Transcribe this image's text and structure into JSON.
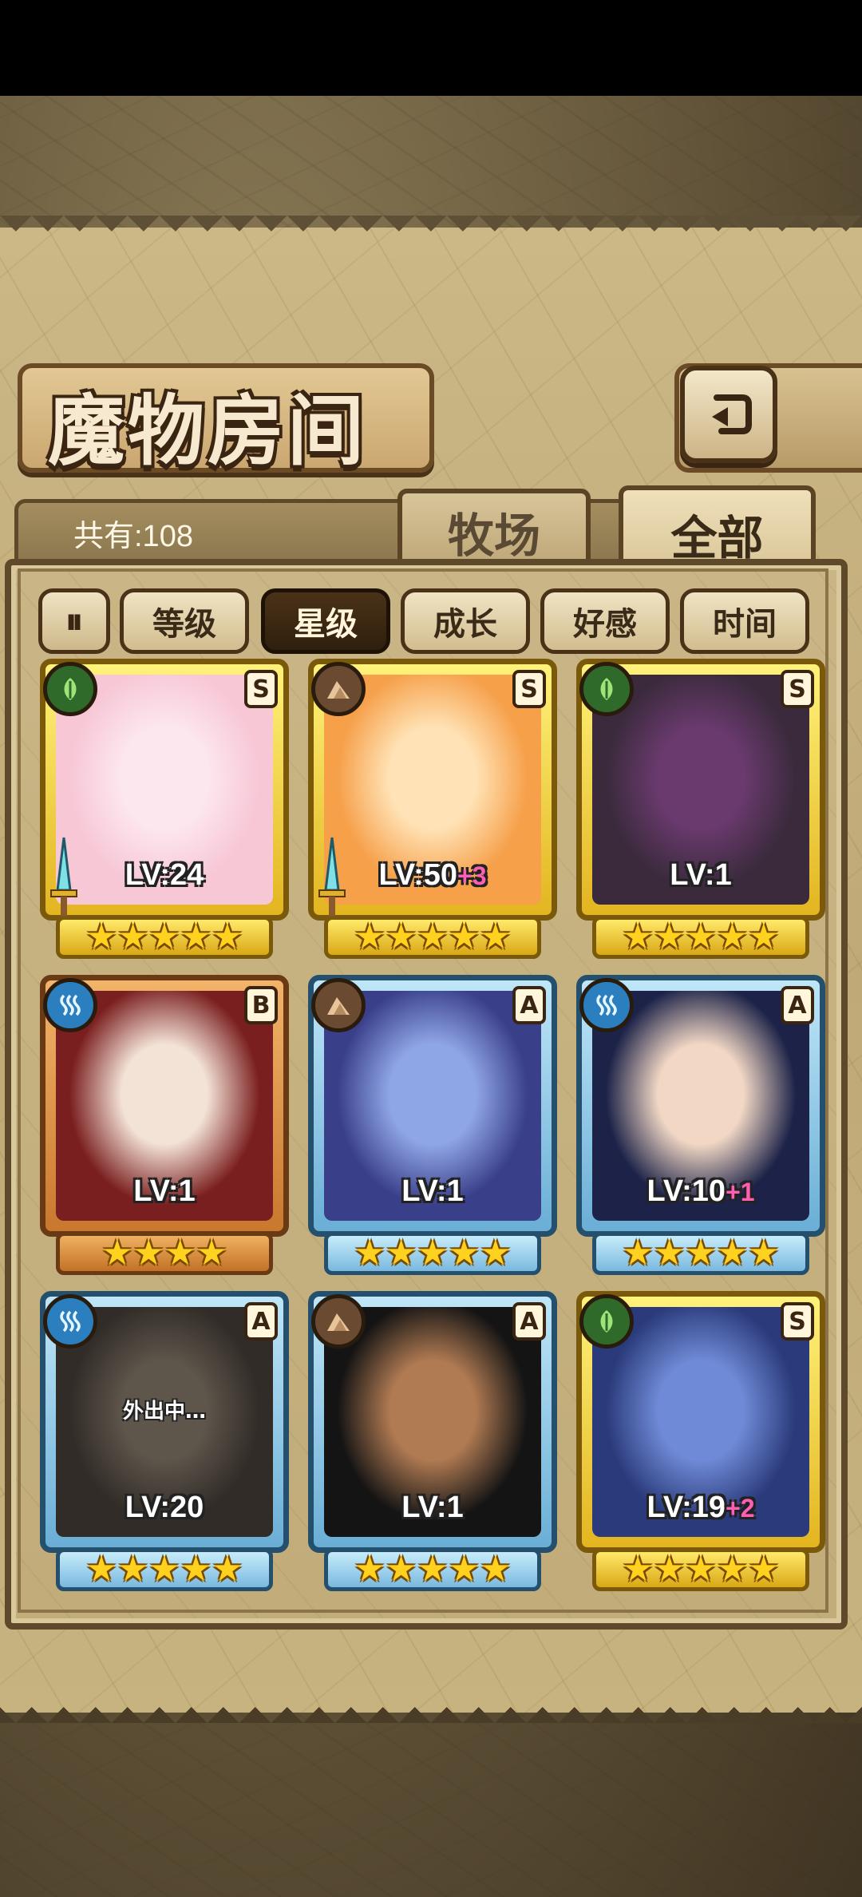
{
  "title": "魔物房间",
  "count_text": "共有:108",
  "tabs": [
    {
      "label": "牧场",
      "active": false
    },
    {
      "label": "全部",
      "active": true
    }
  ],
  "sort_buttons": [
    {
      "label": "等级",
      "active": false
    },
    {
      "label": "星级",
      "active": true
    },
    {
      "label": "成长",
      "active": false
    },
    {
      "label": "好感",
      "active": false
    },
    {
      "label": "时间",
      "active": false
    }
  ],
  "sort_toggle_icon": "pause-sort-icon",
  "back_icon": "back-arrow-icon",
  "monsters": [
    {
      "lv": "LV:24",
      "plus": "",
      "rank": "S",
      "frame": "gold",
      "attr": "leaf-icon",
      "stars": "★★★★★",
      "weapon": true,
      "away": "",
      "portrait": [
        "#f7c7d6",
        "#fde7ee"
      ]
    },
    {
      "lv": "LV:50",
      "plus": "+3",
      "rank": "S",
      "frame": "gold",
      "attr": "rock-icon",
      "stars": "★★★★★",
      "weapon": true,
      "away": "",
      "portrait": [
        "#f6a04a",
        "#ffe3b6"
      ]
    },
    {
      "lv": "LV:1",
      "plus": "",
      "rank": "S",
      "frame": "gold",
      "attr": "leaf-icon",
      "stars": "★★★★★",
      "weapon": false,
      "away": "",
      "portrait": [
        "#3a2a3c",
        "#6a3a6e"
      ]
    },
    {
      "lv": "LV:1",
      "plus": "",
      "rank": "B",
      "frame": "bronze",
      "attr": "wave-icon",
      "stars": "★★★★",
      "weapon": false,
      "away": "",
      "portrait": [
        "#7a1f1f",
        "#f3e2d6"
      ]
    },
    {
      "lv": "LV:1",
      "plus": "",
      "rank": "A",
      "frame": "blue",
      "attr": "rock-icon",
      "stars": "★★★★★",
      "weapon": false,
      "away": "",
      "portrait": [
        "#3a3f8a",
        "#8fa6e6"
      ]
    },
    {
      "lv": "LV:10",
      "plus": "+1",
      "rank": "A",
      "frame": "blue",
      "attr": "wave-icon",
      "stars": "★★★★★",
      "weapon": false,
      "away": "",
      "portrait": [
        "#1c2248",
        "#f1d7c4"
      ]
    },
    {
      "lv": "LV:20",
      "plus": "",
      "rank": "A",
      "frame": "blue",
      "attr": "wave-icon",
      "stars": "★★★★★",
      "weapon": false,
      "away": "外出中…",
      "portrait": [
        "#3a3028",
        "#8a7a68"
      ]
    },
    {
      "lv": "LV:1",
      "plus": "",
      "rank": "A",
      "frame": "blue",
      "attr": "rock-icon",
      "stars": "★★★★★",
      "weapon": false,
      "away": "",
      "portrait": [
        "#141414",
        "#b07a52"
      ]
    },
    {
      "lv": "LV:19",
      "plus": "+2",
      "rank": "S",
      "frame": "gold",
      "attr": "leaf-icon",
      "stars": "★★★★★",
      "weapon": false,
      "away": "",
      "portrait": [
        "#2a3a7a",
        "#6f8ad6"
      ]
    }
  ]
}
